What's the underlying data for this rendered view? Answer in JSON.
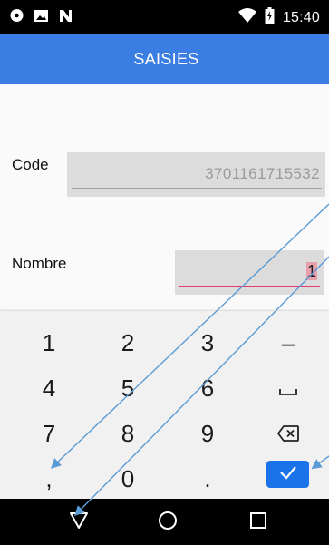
{
  "status_bar": {
    "time": "15:40",
    "left_icons": [
      "messenger-icon",
      "image-icon",
      "n-icon"
    ],
    "right_icons": [
      "wifi-icon",
      "battery-icon"
    ]
  },
  "app_bar": {
    "title": "SAISIES",
    "color": "#3a7de3"
  },
  "form": {
    "code": {
      "label": "Code",
      "value": "3701161715532"
    },
    "nombre": {
      "label": "Nombre",
      "value": "1"
    }
  },
  "keyboard": {
    "keys": [
      {
        "id": "key-1",
        "label": "1"
      },
      {
        "id": "key-2",
        "label": "2"
      },
      {
        "id": "key-3",
        "label": "3"
      },
      {
        "id": "key-minus",
        "label": "–"
      },
      {
        "id": "key-4",
        "label": "4"
      },
      {
        "id": "key-5",
        "label": "5"
      },
      {
        "id": "key-6",
        "label": "6"
      },
      {
        "id": "key-space",
        "label": "␣"
      },
      {
        "id": "key-7",
        "label": "7"
      },
      {
        "id": "key-8",
        "label": "8"
      },
      {
        "id": "key-9",
        "label": "9"
      },
      {
        "id": "key-backspace",
        "label": ""
      },
      {
        "id": "key-comma",
        "label": ","
      },
      {
        "id": "key-0",
        "label": "0"
      },
      {
        "id": "key-period",
        "label": "."
      },
      {
        "id": "key-done",
        "label": ""
      }
    ],
    "done_color": "#1a73e8"
  },
  "nav_bar": {
    "buttons": [
      "back-icon",
      "home-icon",
      "recents-icon"
    ]
  },
  "annotation_color": "#5b9bd5"
}
